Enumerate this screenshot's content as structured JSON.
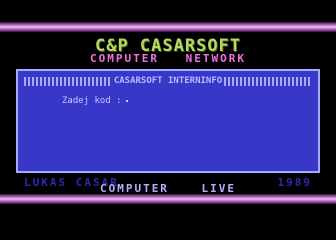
{
  "header": {
    "title": "C&P CASARSOFT",
    "subtitle": "COMPUTER NETWORK"
  },
  "window": {
    "title": "CASARSOFT INTERNINFO",
    "prompt": "Zadej kod :"
  },
  "footer": {
    "credit_name": "LUKAS CASAR",
    "credit_year": "1989",
    "tagline": "COMPUTER LIVE"
  },
  "colors": {
    "background": "#000000",
    "window": "#3838c8",
    "title_green": "#b8d860",
    "subtitle_pink": "#f070e0"
  }
}
